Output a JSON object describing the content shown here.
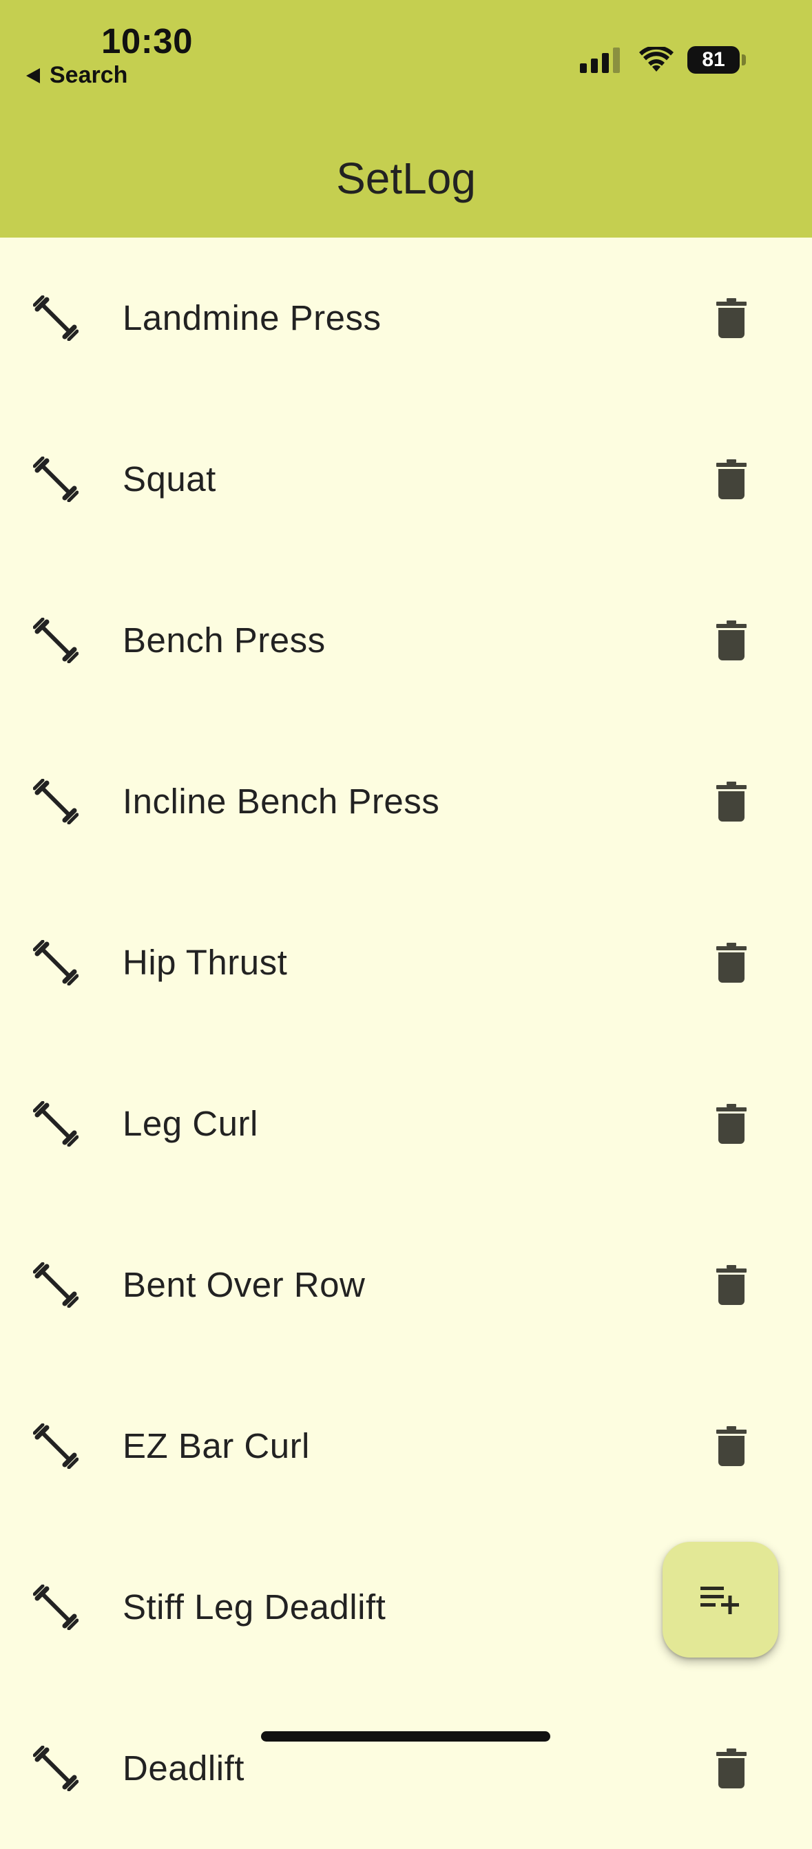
{
  "status_bar": {
    "time": "10:30",
    "back_label": "Search",
    "battery_level": "81"
  },
  "app_bar": {
    "title": "SetLog"
  },
  "exercises": [
    {
      "name": "Landmine Press"
    },
    {
      "name": "Squat"
    },
    {
      "name": "Bench Press"
    },
    {
      "name": "Incline Bench Press"
    },
    {
      "name": "Hip Thrust"
    },
    {
      "name": "Leg Curl"
    },
    {
      "name": "Bent Over Row"
    },
    {
      "name": "EZ Bar Curl"
    },
    {
      "name": "Stiff Leg Deadlift"
    },
    {
      "name": "Deadlift"
    }
  ],
  "icons": {
    "leading": "dumbbell-icon",
    "trailing": "trash-icon",
    "fab": "playlist-add-icon"
  },
  "colors": {
    "app_bar": "#c5cf50",
    "background": "#fdfde0",
    "fab": "#e3e896",
    "icon": "#44443a"
  }
}
